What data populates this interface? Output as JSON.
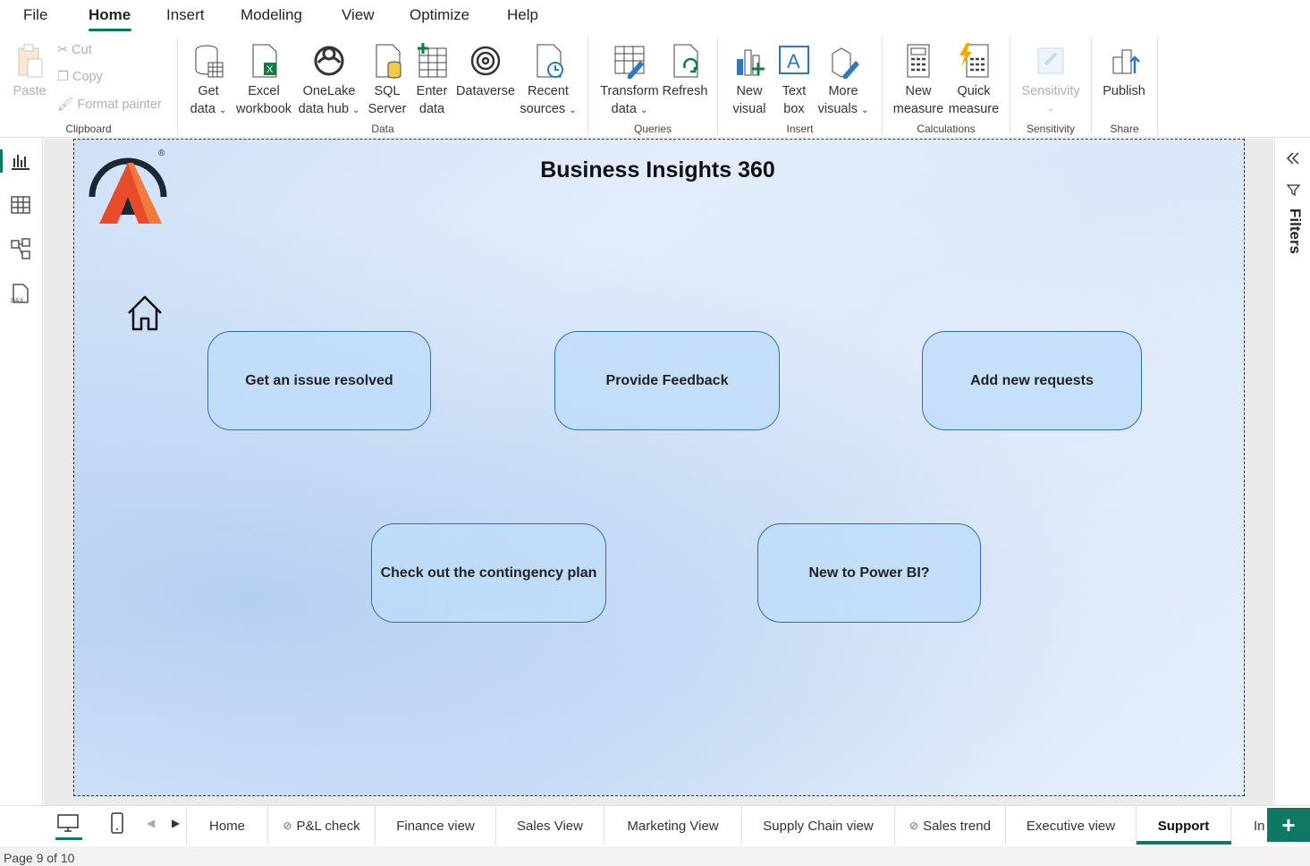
{
  "menu": {
    "items": [
      "File",
      "Home",
      "Insert",
      "Modeling",
      "View",
      "Optimize",
      "Help"
    ],
    "active": "Home"
  },
  "ribbon": {
    "clipboard": {
      "paste": "Paste",
      "cut": "Cut",
      "copy": "Copy",
      "format_painter": "Format painter",
      "label": "Clipboard"
    },
    "data": {
      "get_data_1": "Get",
      "get_data_2": "data",
      "excel_1": "Excel",
      "excel_2": "workbook",
      "onelake_1": "OneLake",
      "onelake_2": "data hub",
      "sql_1": "SQL",
      "sql_2": "Server",
      "enter_1": "Enter",
      "enter_2": "data",
      "dataverse": "Dataverse",
      "recent_1": "Recent",
      "recent_2": "sources",
      "label": "Data"
    },
    "queries": {
      "transform_1": "Transform",
      "transform_2": "data",
      "refresh": "Refresh",
      "label": "Queries"
    },
    "insert": {
      "new_visual_1": "New",
      "new_visual_2": "visual",
      "text_box_1": "Text",
      "text_box_2": "box",
      "more_visuals_1": "More",
      "more_visuals_2": "visuals",
      "label": "Insert"
    },
    "calculations": {
      "new_measure_1": "New",
      "new_measure_2": "measure",
      "quick_measure_1": "Quick",
      "quick_measure_2": "measure",
      "label": "Calculations"
    },
    "sensitivity": {
      "button": "Sensitivity",
      "label": "Sensitivity"
    },
    "share": {
      "publish": "Publish",
      "label": "Share"
    }
  },
  "report": {
    "title": "Business Insights 360",
    "logo_mark": "®",
    "cards": {
      "issue": "Get an issue resolved",
      "feedback": "Provide Feedback",
      "requests": "Add new requests",
      "contingency": "Check out the contingency plan",
      "new_pbi": "New to Power BI?"
    }
  },
  "filters_pane": {
    "label": "Filters"
  },
  "tabs": {
    "home": "Home",
    "pl_check": "P&L check",
    "finance": "Finance view",
    "sales": "Sales View",
    "marketing": "Marketing View",
    "supply_chain": "Supply Chain view",
    "sales_trend": "Sales trend",
    "executive": "Executive view",
    "support": "Support",
    "partial": "In",
    "active": "Support"
  },
  "status": {
    "page": "Page 9 of 10"
  },
  "colors": {
    "accent": "#117865",
    "card_border": "#2f6fb0",
    "card_fill": "#bedcfa"
  }
}
